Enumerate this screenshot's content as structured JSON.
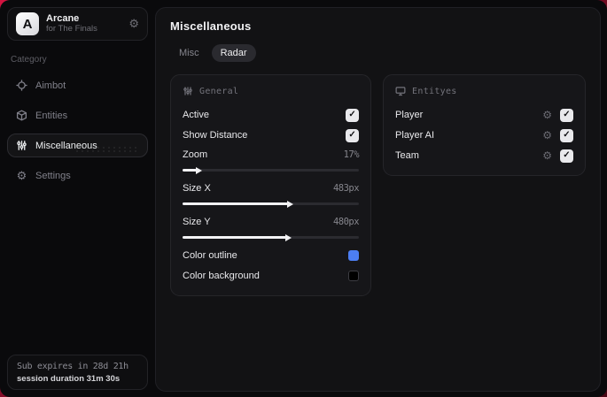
{
  "sidebar": {
    "brand": {
      "initial": "A",
      "title": "Arcane",
      "subtitle": "for The Finals",
      "icon": "gear-icon"
    },
    "category_label": "Category",
    "items": [
      {
        "label": "Aimbot",
        "icon": "crosshair-icon",
        "selected": false
      },
      {
        "label": "Entities",
        "icon": "cube-icon",
        "selected": false
      },
      {
        "label": "Miscellaneous",
        "icon": "sliders-icon",
        "selected": true
      },
      {
        "label": "Settings",
        "icon": "gear-icon",
        "selected": false
      }
    ],
    "footer": {
      "expiry": "Sub expires in 28d 21h",
      "session": "session duration 31m 30s"
    }
  },
  "main": {
    "title": "Miscellaneous",
    "tabs": [
      {
        "label": "Misc",
        "selected": false
      },
      {
        "label": "Radar",
        "selected": true
      }
    ],
    "general_panel": {
      "title": "General",
      "icon": "sliders-icon",
      "toggles": [
        {
          "label": "Active",
          "checked": true
        },
        {
          "label": "Show Distance",
          "checked": true
        }
      ],
      "sliders": [
        {
          "label": "Zoom",
          "value": "17%",
          "percent": 8
        },
        {
          "label": "Size X",
          "value": "483px",
          "percent": 60
        },
        {
          "label": "Size Y",
          "value": "480px",
          "percent": 59
        }
      ],
      "colors": [
        {
          "label": "Color outline",
          "color": "#4c7ef3"
        },
        {
          "label": "Color background",
          "color": "#000000"
        }
      ]
    },
    "entities_panel": {
      "title": "Entityes",
      "icon": "monitor-icon",
      "rows": [
        {
          "label": "Player",
          "icon": "gear-icon",
          "checked": true
        },
        {
          "label": "Player AI",
          "icon": "gear-icon",
          "checked": true
        },
        {
          "label": "Team",
          "icon": "gear-icon",
          "checked": true
        }
      ]
    }
  },
  "colors": {
    "desktop_red": "#c01236",
    "accent_blue": "#4c7ef3",
    "checkbox_bg": "#e9e9ec"
  }
}
